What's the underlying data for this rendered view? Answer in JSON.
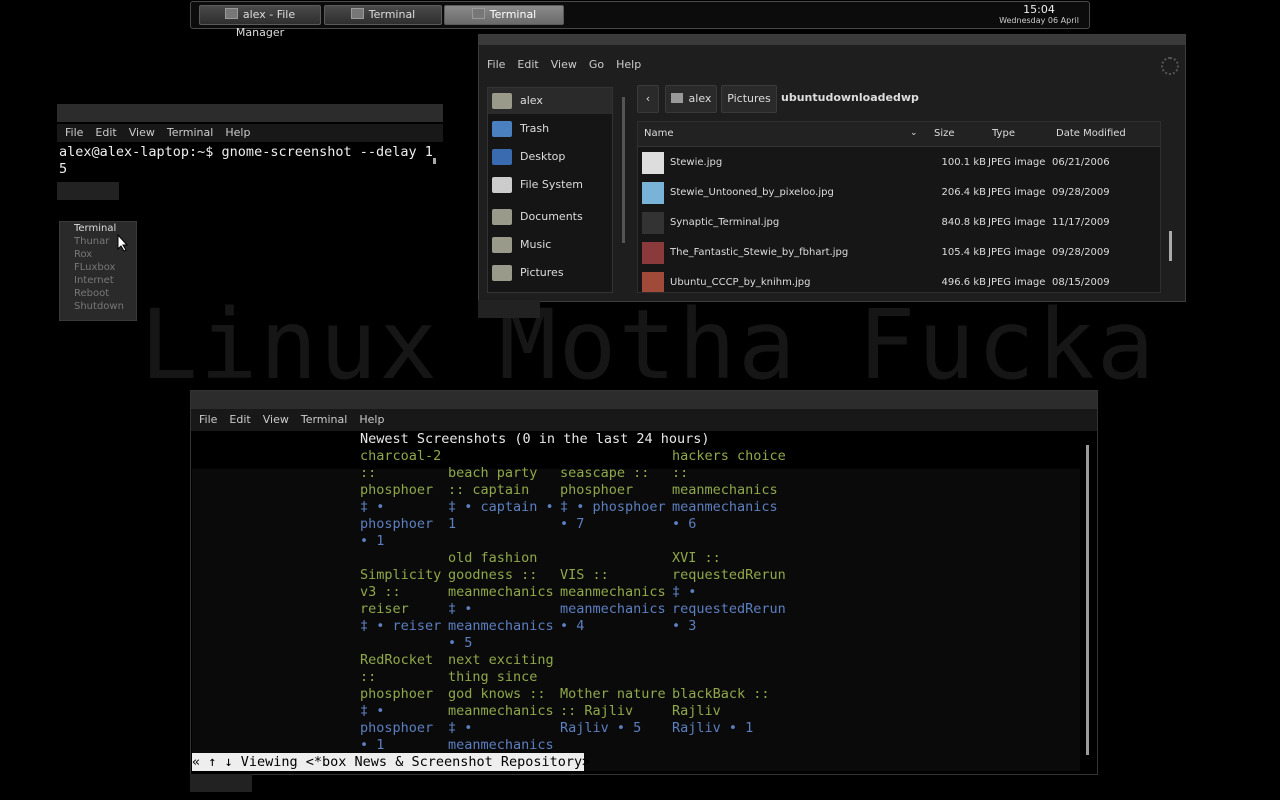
{
  "taskbar": {
    "tasks": [
      {
        "label": "alex - File Manager",
        "active": false
      },
      {
        "label": "Terminal",
        "active": false
      },
      {
        "label": "Terminal",
        "active": true
      }
    ],
    "time": "15:04",
    "date": "Wednesday 06 April"
  },
  "wallpaper_text": "Linux Motha Fucka",
  "term_small": {
    "menu": [
      "File",
      "Edit",
      "View",
      "Terminal",
      "Help"
    ],
    "line1": "alex@alex-laptop:~$ gnome-screenshot --delay 1",
    "line2": "5"
  },
  "root_menu": {
    "items": [
      "Terminal",
      "Thunar",
      "Rox",
      "FLuxbox",
      "Internet",
      "Reboot",
      "Shutdown"
    ],
    "selected": "Terminal"
  },
  "file_manager": {
    "menu": [
      "File",
      "Edit",
      "View",
      "Go",
      "Help"
    ],
    "sidebar": [
      "alex",
      "Trash",
      "Desktop",
      "File System",
      "Documents",
      "Music",
      "Pictures"
    ],
    "breadcrumb": [
      "alex",
      "Pictures",
      "ubuntudownloadedwp"
    ],
    "columns": [
      "Name",
      "Size",
      "Type",
      "Date Modified"
    ],
    "rows": [
      {
        "name": "Stewie.jpg",
        "size": "100.1 kB",
        "type": "JPEG image",
        "date": "06/21/2006"
      },
      {
        "name": "Stewie_Untooned_by_pixeloo.jpg",
        "size": "206.4 kB",
        "type": "JPEG image",
        "date": "09/28/2009"
      },
      {
        "name": "Synaptic_Terminal.jpg",
        "size": "840.8 kB",
        "type": "JPEG image",
        "date": "11/17/2009"
      },
      {
        "name": "The_Fantastic_Stewie_by_fbhart.jpg",
        "size": "105.4 kB",
        "type": "JPEG image",
        "date": "09/28/2009"
      },
      {
        "name": "Ubuntu_CCCP_by_knihm.jpg",
        "size": "496.6 kB",
        "type": "JPEG image",
        "date": "08/15/2009"
      }
    ]
  },
  "term_big": {
    "menu": [
      "File",
      "Edit",
      "View",
      "Terminal",
      "Help"
    ],
    "heading": "Newest Screenshots (0 in the last 24 hours)",
    "lines": [
      {
        "c1": [
          "charcoal-2",
          "::",
          "phosphoer"
        ],
        "c4": [
          "hackers choice",
          "::",
          "meanmechanics"
        ]
      },
      {
        "c2": [
          "beach party",
          ":: captain"
        ],
        "c3": [
          "seascape ::",
          "phosphoer"
        ]
      }
    ],
    "cells": {
      "r1": [
        [
          "charcoal-2",
          "::",
          "phosphoer",
          "‡ •",
          "phosphoer",
          "• 1"
        ],
        [
          "",
          "beach party",
          ":: captain",
          "‡ • captain •",
          "1",
          ""
        ],
        [
          "",
          "seascape ::",
          "phosphoer",
          "‡ • phosphoer",
          "• 7",
          ""
        ],
        [
          "hackers choice",
          "::",
          "meanmechanics",
          "meanmechanics",
          "• 6",
          ""
        ]
      ],
      "r2": [
        [
          "",
          "Simplicity",
          "v3 ::",
          "reiser",
          "‡ • reiser",
          ""
        ],
        [
          "old fashion",
          "goodness ::",
          "meanmechanics",
          "‡ •",
          "meanmechanics",
          "• 5"
        ],
        [
          "",
          "VIS ::",
          "meanmechanics",
          "meanmechanics",
          "• 4",
          ""
        ],
        [
          "XVI ::",
          "requestedRerun",
          "‡ •",
          "requestedRerun",
          "• 3",
          ""
        ]
      ],
      "r3": [
        [
          "RedRocket",
          "::",
          "phosphoer",
          "‡ •",
          "phosphoer",
          "• 1"
        ],
        [
          "next exciting",
          "thing since",
          "god knows ::",
          "meanmechanics",
          "‡ •",
          "meanmechanics"
        ],
        [
          "",
          "",
          "Mother nature",
          ":: Rajliv",
          "Rajliv • 5",
          ""
        ],
        [
          "",
          "",
          "blackBack ::",
          "Rajliv",
          "Rajliv • 1",
          ""
        ]
      ]
    },
    "status": "« ↑ ↓ Viewing <*box News & Screenshot Repository>"
  },
  "colors": {
    "green": "#8fa84a",
    "blue": "#5c7fc0"
  }
}
